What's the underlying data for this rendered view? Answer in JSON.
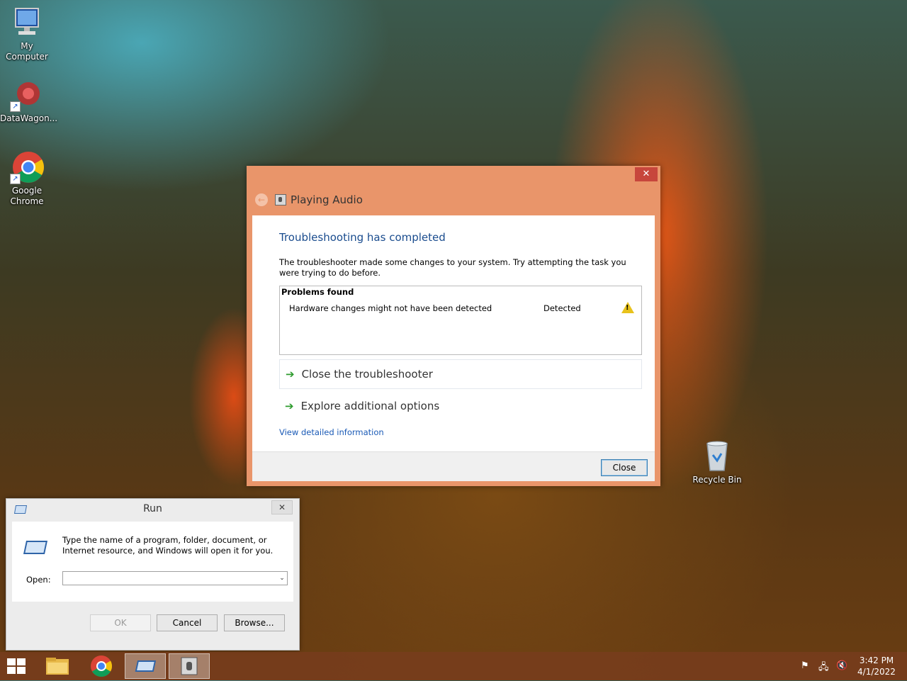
{
  "desktop": {
    "icons": [
      {
        "label_line1": "My",
        "label_line2": "Computer"
      },
      {
        "label_line1": "DataWagon...",
        "label_line2": ""
      },
      {
        "label_line1": "Google",
        "label_line2": "Chrome"
      }
    ],
    "recycle_bin": "Recycle Bin"
  },
  "troubleshooter": {
    "window_title": "Playing Audio",
    "close_glyph": "✕",
    "back_glyph": "←",
    "heading": "Troubleshooting has completed",
    "description": "The troubleshooter made some changes to your system. Try attempting the task you were trying to do before.",
    "problems_header": "Problems found",
    "problems": [
      {
        "name": "Hardware changes might not have been detected",
        "status": "Detected",
        "icon": "warning-icon"
      }
    ],
    "options": [
      {
        "arrow": "➔",
        "label": "Close the troubleshooter"
      },
      {
        "arrow": "➔",
        "label": "Explore additional options"
      }
    ],
    "detail_link": "View detailed information",
    "close_button": "Close"
  },
  "run_dialog": {
    "title": "Run",
    "close_glyph": "✕",
    "description": "Type the name of a program, folder, document, or Internet resource, and Windows will open it for you.",
    "open_label": "Open:",
    "open_value": "",
    "dropdown_glyph": "⌄",
    "ok_button": "OK",
    "cancel_button": "Cancel",
    "browse_button": "Browse..."
  },
  "taskbar": {
    "items": [
      "start-icon",
      "file-explorer-icon",
      "chrome-icon",
      "run-icon",
      "troubleshooter-icon"
    ],
    "time": "3:42 PM",
    "date": "4/1/2022"
  }
}
